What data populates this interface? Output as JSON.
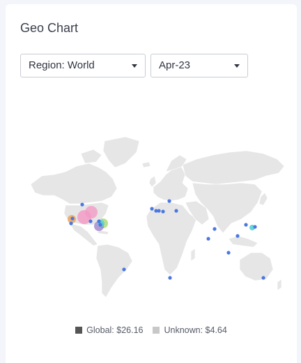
{
  "card": {
    "title": "Geo Chart"
  },
  "filters": {
    "region": {
      "label": "Region: World"
    },
    "date": {
      "label": "Apr-23"
    }
  },
  "chart_data": {
    "type": "geo",
    "legend": [
      {
        "label": "Global: $26.16",
        "color": "#555555"
      },
      {
        "label": "Unknown: $4.64",
        "color": "#c8c8c8"
      }
    ]
  },
  "colors": {
    "marker_default": "#4a78e0",
    "bubble_pink": "#f39bc4",
    "bubble_orange": "#f0a050",
    "bubble_green": "#a8d870",
    "bubble_cyan": "#55d0d8",
    "bubble_purple": "#9a7ac8"
  }
}
